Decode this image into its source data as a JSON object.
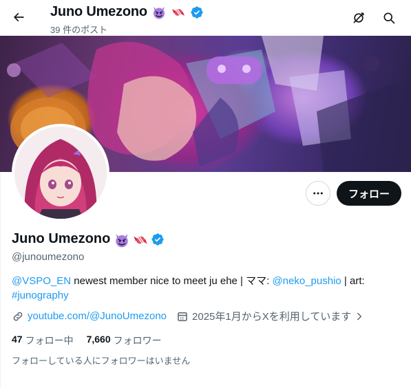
{
  "header": {
    "name": "Juno Umezono",
    "post_count": "39 件のポスト",
    "back_icon": "arrow-left-icon",
    "notifications_icon": "bell-slash-icon",
    "search_icon": "search-icon"
  },
  "profile": {
    "name": "Juno Umezono",
    "handle": "@junoumezono",
    "bio": {
      "mention1": "@VSPO_EN",
      "text1": " newest member nice to meet ju ehe | ママ: ",
      "mention2": "@neko_pushio",
      "text2": " | art: ",
      "hashtag": "#junography"
    },
    "website": "youtube.com/@JunoUmezono",
    "joined": "2025年1月からXを利用しています",
    "following": {
      "count": "47",
      "label": "フォロー中"
    },
    "followers": {
      "count": "7,660",
      "label": "フォロワー"
    },
    "followers_note": "フォローしている人にフォロワーはいません"
  },
  "actions": {
    "follow_label": "フォロー",
    "more_icon": "more-dots-icon"
  },
  "colors": {
    "accent": "#1d9bf0",
    "text_primary": "#0f1419",
    "text_secondary": "#536471",
    "button_dark": "#0f1419",
    "verified": "#1d9bf0"
  }
}
